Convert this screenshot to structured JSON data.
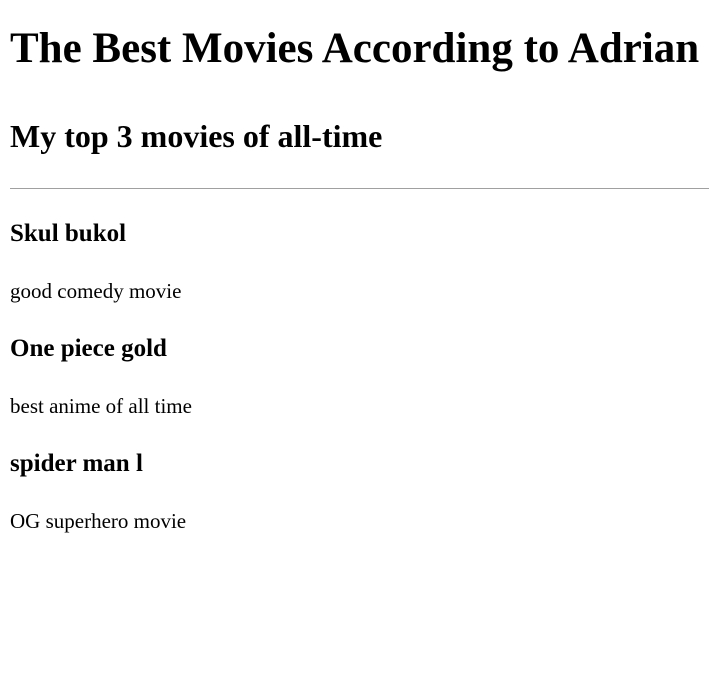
{
  "page": {
    "title": "The Best Movies According to Adrian",
    "subtitle": "My top 3 movies of all-time"
  },
  "movies": [
    {
      "title": "Skul bukol",
      "description": "good comedy movie"
    },
    {
      "title": "One piece gold",
      "description": "best anime of all time"
    },
    {
      "title": "spider man l",
      "description": "OG superhero movie"
    }
  ]
}
